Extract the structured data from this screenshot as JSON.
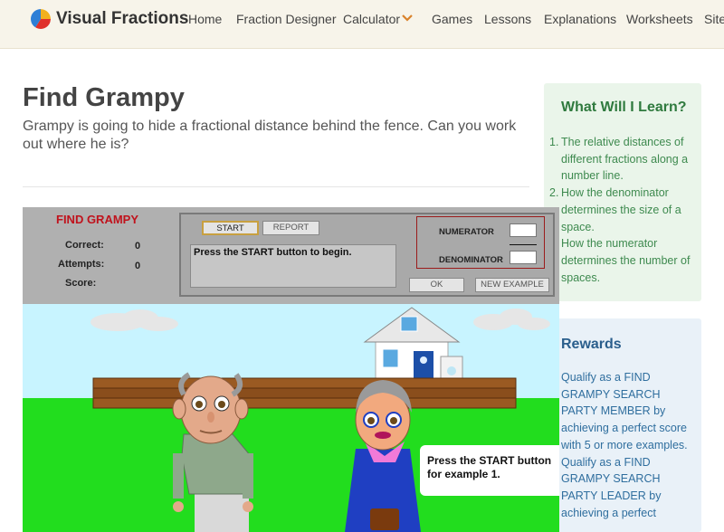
{
  "header": {
    "brand": "Visual Fractions",
    "nav": [
      "Home",
      "Fraction Designer",
      "Calculator",
      "Games",
      "Lessons",
      "Explanations",
      "Worksheets",
      "Site"
    ]
  },
  "page": {
    "title": "Find Grampy",
    "lead": "Grampy is going to hide a fractional distance behind the fence. Can you work out where he is?"
  },
  "learn": {
    "title": "What Will I Learn?",
    "items": [
      "The relative distances of different fractions along a number line.",
      "How the denominator determines the size of a space.",
      "How the numerator determines the number of spaces."
    ]
  },
  "rewards": {
    "title": "Rewards",
    "items": [
      "Qualify as a FIND GRAMPY SEARCH PARTY MEMBER by achieving a perfect score with 5 or more examples.",
      "Qualify as a FIND GRAMPY SEARCH PARTY LEADER by achieving a perfect"
    ]
  },
  "game": {
    "title": "FIND GRAMPY",
    "correct_label": "Correct:",
    "correct": "0",
    "attempts_label": "Attempts:",
    "attempts": "0",
    "score_label": "Score:",
    "start": "START",
    "report": "REPORT",
    "message": "Press the START button to begin.",
    "numerator": "NUMERATOR",
    "denominator": "DENOMINATOR",
    "ok": "OK",
    "new_example": "NEW EXAMPLE",
    "speech": "Press the START button for example 1."
  },
  "colors": {
    "brand_red": "#c0121c",
    "sky": "#c8f4ff",
    "grass": "#22dd1e"
  }
}
